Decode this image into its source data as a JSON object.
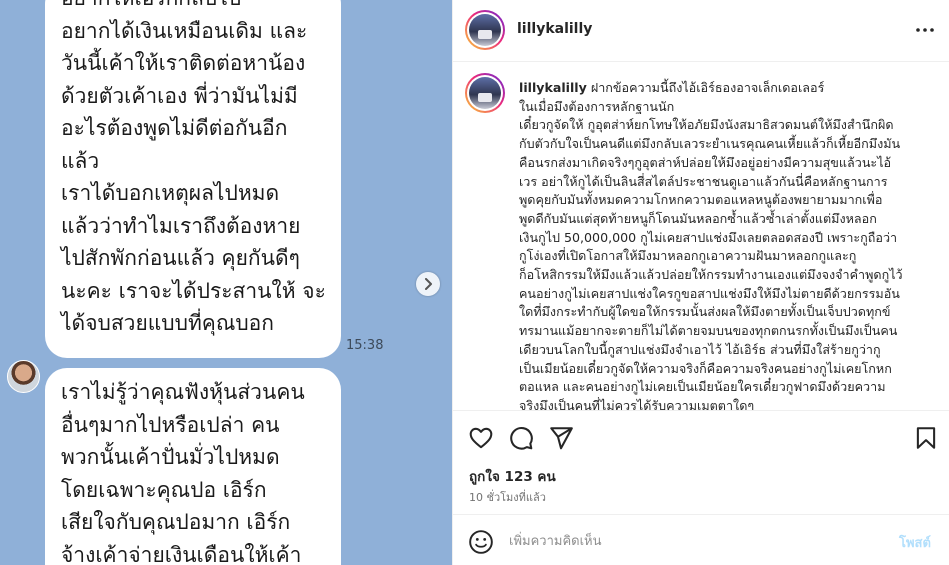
{
  "media": {
    "bubble1_lines": [
      "อยากให้เอิร์กกลับไป",
      "อยากได้เงินเหมือนเดิม และ",
      "วันนี้เค้าให้เราติดต่อหาน้อง",
      "ด้วยตัวเค้าเอง พี่ว่ามันไม่มี",
      "อะไรต้องพูดไม่ดีต่อกันอีก",
      "แล้ว",
      "เราได้บอกเหตุผลไปหมด",
      "แล้วว่าทำไมเราถึงต้องหาย",
      "ไปสักพักก่อนแล้ว คุยกันดีๆ",
      "นะคะ เราจะได้ประสานให้ จะ",
      "ได้จบสวยแบบที่คุณบอก"
    ],
    "timestamp": "15:38",
    "bubble2_lines": [
      "เราไม่รู้ว่าคุณฟังหุ้นส่วนคน",
      "อื่นๆมากไปหรือเปล่า คน",
      "พวกนั้นเค้าปั่นมั่วไปหมด",
      "โดยเฉพาะคุณปอ เอิร์ก",
      "เสียใจกับคุณปอมาก เอิร์ก",
      "จ้างเค้าจ่ายเงินเดือนให้เค้า"
    ]
  },
  "header": {
    "username": "lillykalilly",
    "more_icon": "more-horizontal-icon"
  },
  "caption": {
    "username": "lillykalilly",
    "first_line": "ฝากข้อความนี้ถึงไอ้เอิร์ธองอาจเล็กเดอเลอร์",
    "lines": [
      "ในเมื่อมึงต้องการหลักฐานนัก",
      "เดี๋ยวกูจัดให้ กูอุตส่าห์ยกโทษให้อภัยมึงนังสมาธิสวดมนต์ให้มึงสำนึกผิด",
      "กับตัวกับใจเป็นคนดีแต่มึงกลับเลวระยำเนรคุณคนเหี้ยแล้วก็เหี้ยอีกมึงมัน",
      "คือนรกส่งมาเกิดจริงๆกูอุตส่าห์ปล่อยให้มึงอยู่อย่างมีความสุขแล้วนะไอ้",
      "เวร อย่าให้กูได้เป็นลินสี่สไตล์ประชาชนดูเอาแล้วกันนี่คือหลักฐานการ",
      "พูดคุยกับมันทั้งหมดความโกหกความตอแหลหนูต้องพยายามมากเพื่อ",
      "พูดดีกับมันแต่สุดท้ายหนูก็โดนมันหลอกซ้ำแล้วซ้ำเล่าตั้งแต่มึงหลอก",
      "เงินกูไป 50,000,000 กูไม่เคยสาปแช่งมึงเลยตลอดสองปี เพราะกูถือว่า",
      "กูโง่เองที่เปิดโอกาสให้มึงมาหลอกกูเอาความฝันมาหลอกกูและกู",
      "ก็อโหสิกรรมให้มึงแล้วแล้วปล่อยให้กรรมทำงานเองแต่มึงจงจำคำพูดกูไว้",
      "คนอย่างกูไม่เคยสาปแช่งใครกูขอสาปแช่งมึงให้มึงไม่ตายดีด้วยกรรมอัน",
      "ใดที่มึงกระทำกับผู้ใดขอให้กรรมนั้นส่งผลให้มึงตายทั้งเป็นเจ็บปวดทุกข์",
      "ทรมานแม้อยากจะตายก็ไม่ได้ตายจมบนของทุกตกนรกทั้งเป็นมึงเป็นคน",
      "เดียวบนโลกใบนี้กูสาปแช่งมึงจำเอาไว้ ไอ้เอิร์ธ ส่วนที่มึงใส่ร้ายกูว่ากู",
      "เป็นเมียน้อยเดี๋ยวกูจัดให้ความจริงก็คือความจริงคนอย่างกูไม่เคยโกหก",
      "ตอแหล และคนอย่างกูไม่เคยเป็นเมียน้อยใครเดี๋ยวกูฟาดมึงด้วยความ",
      "จริงมึงเป็นคนที่ไม่ควรได้รับความเมตตาใดๆ"
    ]
  },
  "actions": {
    "like_icon": "heart-icon",
    "comment_icon": "comment-icon",
    "share_icon": "paper-plane-icon",
    "save_icon": "bookmark-icon",
    "likes_text": "ถูกใจ 123 คน",
    "time_ago": "10 ชั่วโมงที่แล้ว"
  },
  "comment_bar": {
    "emoji_icon": "emoji-icon",
    "placeholder": "เพิ่มความคิดเห็น",
    "post_label": "โพสต์"
  }
}
